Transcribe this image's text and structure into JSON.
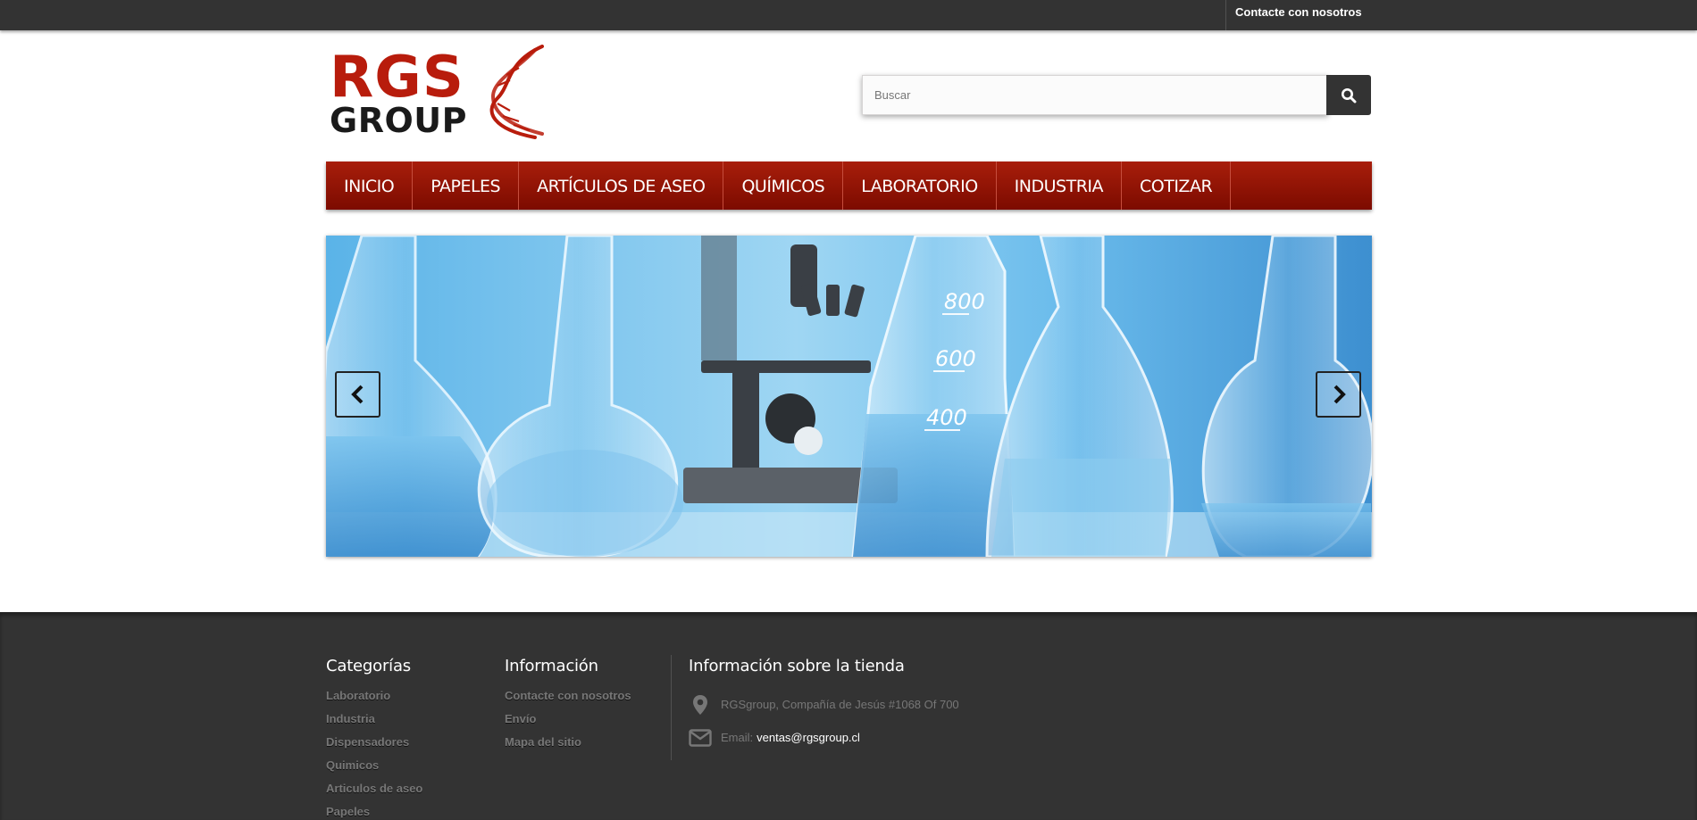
{
  "topbar": {
    "contact_label": "Contacte con nosotros"
  },
  "header": {
    "logo": {
      "word1": "RGS",
      "word2": "GROUP"
    },
    "search": {
      "placeholder": "Buscar"
    }
  },
  "nav": {
    "items": [
      {
        "label": "INICIO"
      },
      {
        "label": "PAPELES"
      },
      {
        "label": "ARTÍCULOS DE ASEO"
      },
      {
        "label": "QUÍMICOS"
      },
      {
        "label": "LABORATORIO"
      },
      {
        "label": "INDUSTRIA"
      },
      {
        "label": "COTIZAR"
      }
    ]
  },
  "slider": {
    "flask_marks": [
      "800",
      "600",
      "400"
    ]
  },
  "footer": {
    "categories": {
      "title": "Categorías",
      "items": [
        "Laboratorio",
        "Industria",
        "Dispensadores",
        "Quimicos",
        "Articulos de aseo",
        "Papeles"
      ]
    },
    "information": {
      "title": "Información",
      "items": [
        "Contacte con nosotros",
        "Envío",
        "Mapa del sitio"
      ]
    },
    "store": {
      "title": "Información sobre la tienda",
      "address": "RGSgroup, Compañía de Jesús #1068 Of 700",
      "email_label": "Email:",
      "email": "ventas@rgsgroup.cl"
    }
  },
  "colors": {
    "brand_red": "#a81e0b",
    "dark": "#333333"
  },
  "icons": [
    "search-icon",
    "chevron-left-icon",
    "chevron-right-icon",
    "map-marker-icon",
    "envelope-icon"
  ]
}
